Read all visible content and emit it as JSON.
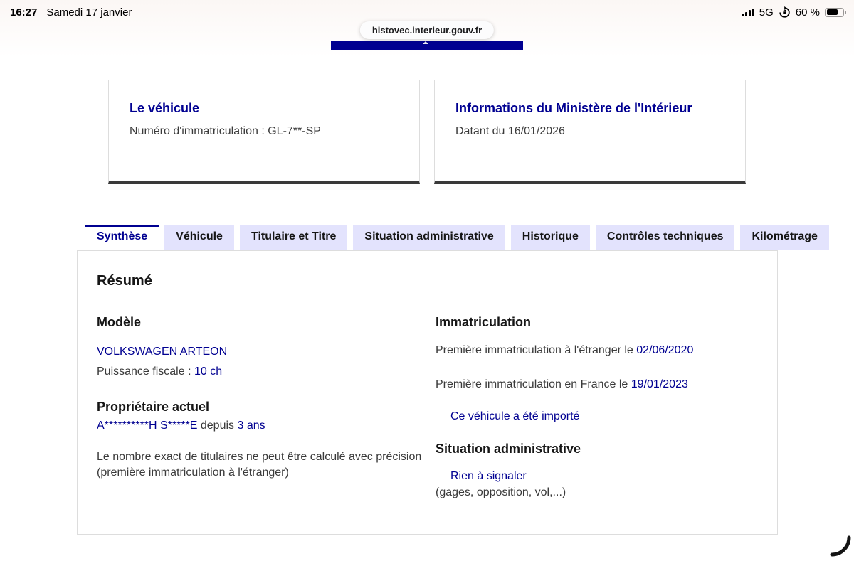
{
  "colors": {
    "accent": "#000091",
    "tab_inactive_bg": "#e3e3fd",
    "text_dark": "#161616",
    "text_muted": "#3a3a3a",
    "card_underline": "#3a3a3a"
  },
  "status_bar": {
    "time": "16:27",
    "date": "Samedi 17 janvier",
    "network": "5G",
    "battery_percent": "60 %",
    "battery_level": 60,
    "icons": {
      "signal": "cellular-signal-bars",
      "lock": "orientation-lock",
      "battery": "battery"
    }
  },
  "browser": {
    "url": "histovec.interieur.gouv.fr"
  },
  "header_cards": [
    {
      "title": "Le véhicule",
      "body": "Numéro d'immatriculation : GL-7**-SP"
    },
    {
      "title": "Informations du Ministère de l'Intérieur",
      "body": "Datant du 16/01/2026"
    }
  ],
  "tabs": [
    {
      "label": "Synthèse",
      "active": true
    },
    {
      "label": "Véhicule",
      "active": false
    },
    {
      "label": "Titulaire et Titre",
      "active": false
    },
    {
      "label": "Situation administrative",
      "active": false
    },
    {
      "label": "Historique",
      "active": false
    },
    {
      "label": "Contrôles techniques",
      "active": false
    },
    {
      "label": "Kilométrage",
      "active": false
    }
  ],
  "panel": {
    "title": "Résumé",
    "model": {
      "heading": "Modèle",
      "name": "VOLKSWAGEN ARTEON",
      "power_label": "Puissance fiscale :",
      "power_value": "10 ch"
    },
    "owner": {
      "heading": "Propriétaire actuel",
      "name": "A**********H S*****E",
      "since_label": "depuis",
      "since_value": "3 ans",
      "note": "Le nombre exact de titulaires ne peut être calculé avec précision (première immatriculation à l'étranger)"
    },
    "registration": {
      "heading": "Immatriculation",
      "foreign_label": "Première immatriculation à l'étranger le",
      "foreign_date": "02/06/2020",
      "france_label": "Première immatriculation en France le",
      "france_date": "19/01/2023",
      "imported_link": "Ce véhicule a été importé"
    },
    "admin_status": {
      "heading": "Situation administrative",
      "status_link": "Rien à signaler",
      "status_detail": "(gages, opposition, vol,...)"
    }
  }
}
